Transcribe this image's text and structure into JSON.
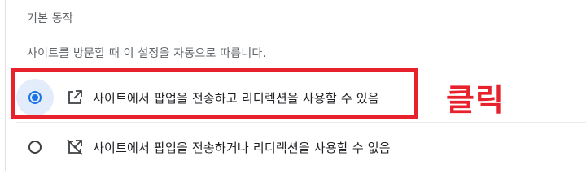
{
  "section": {
    "title": "기본 동작",
    "description": "사이트를 방문할 때 이 설정을 자동으로 따릅니다."
  },
  "options": [
    {
      "label": "사이트에서 팝업을 전송하고 리디렉션을 사용할 수 있음",
      "selected": true,
      "icon": "open-in-new-icon"
    },
    {
      "label": "사이트에서 팝업을 전송하거나 리디렉션을 사용할 수 없음",
      "selected": false,
      "icon": "open-in-new-off-icon"
    }
  ],
  "annotation": {
    "text": "클릭",
    "color": "#e8222d"
  },
  "colors": {
    "accent": "#1a73e8",
    "selected_bg": "#e3ecfa"
  }
}
